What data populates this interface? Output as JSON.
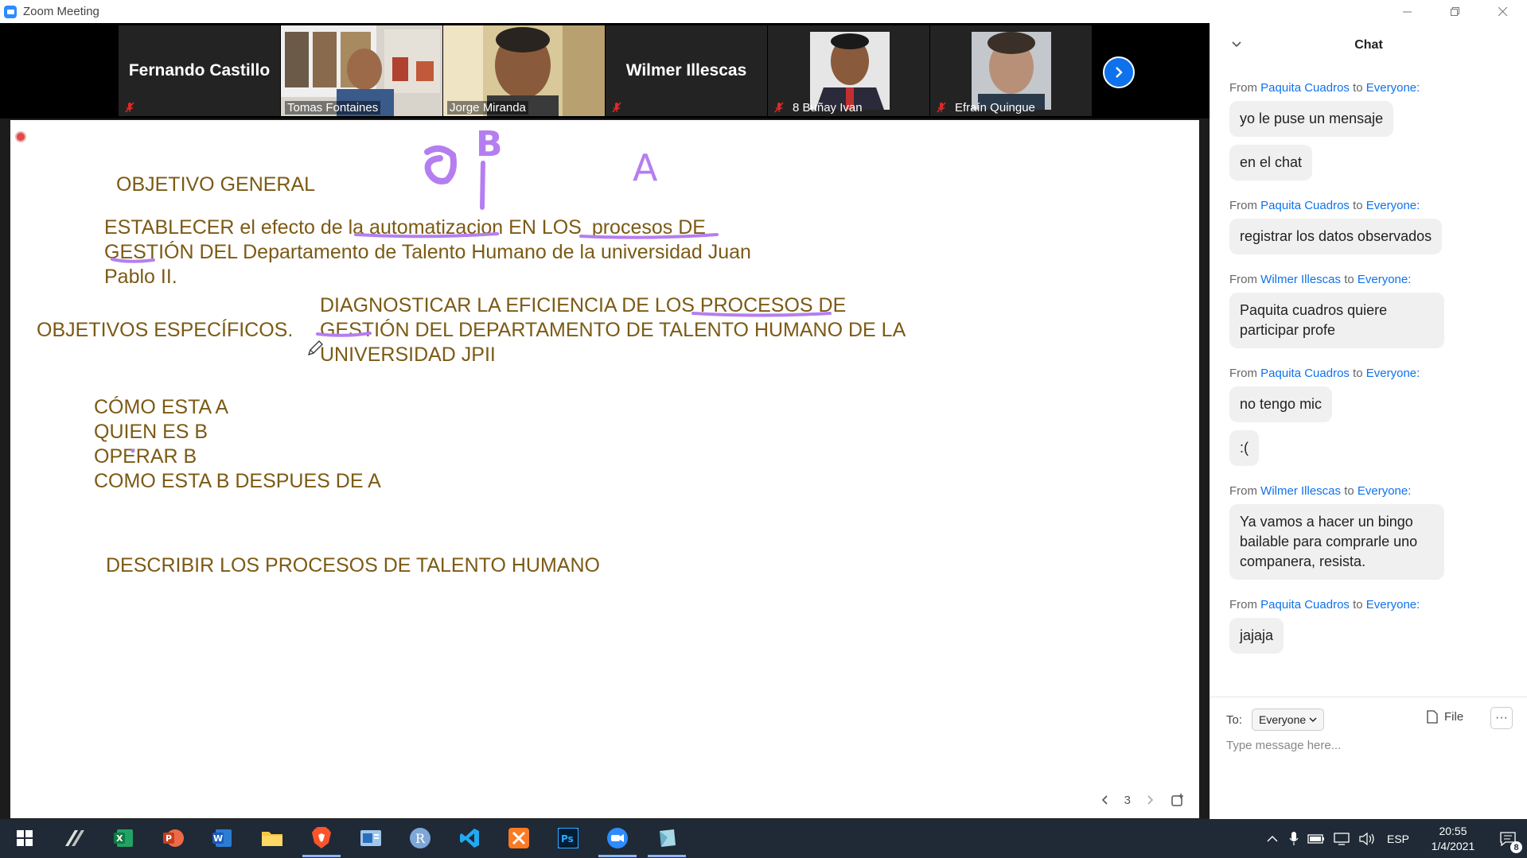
{
  "window": {
    "title": "Zoom Meeting"
  },
  "participants": [
    {
      "name": "Fernando Castillo",
      "type": "name-only",
      "muted": true
    },
    {
      "name": "Tomas Fontaines",
      "type": "video",
      "muted": false,
      "active": true
    },
    {
      "name": "Jorge Miranda",
      "type": "video",
      "muted": false
    },
    {
      "name": "Wilmer Illescas",
      "type": "name-only",
      "muted": true
    },
    {
      "name": "8 Buñay Ivan",
      "type": "photo",
      "muted": true
    },
    {
      "name": "Efraín Quingue",
      "type": "photo",
      "muted": true
    }
  ],
  "whiteboard": {
    "objetivo_general": "OBJETIVO GENERAL",
    "general_line1_a": "ESTABLECER el efecto de la",
    "general_line1_b": "automatizacion",
    "general_line1_c": "EN LOS",
    "general_line1_d": "procesos DE",
    "general_line2": "GESTIÓN DEL  Departamento de Talento Humano de la universidad Juan",
    "general_line3": "Pablo II.",
    "objetivos_especificos": "OBJETIVOS ESPECÍFICOS.",
    "esp_line1": "DIAGNOSTICAR LA EFICIENCIA DE LOS PROCESOS DE",
    "esp_line2": "GESTIÓN  DEL DEPARTAMENTO DE TALENTO HUMANO DE LA",
    "esp_line3": "UNIVERSIDAD  JPII",
    "step1": "CÓMO ESTA A",
    "step2": "QUIEN ES B",
    "step3": "OPERAR B",
    "step4": "COMO ESTA B DESPUES DE A",
    "describir": "DESCRIBIR LOS PROCESOS DE TALENTO HUMANO",
    "annotation_a": "A",
    "annotation_b": "B",
    "page": "3"
  },
  "chat": {
    "title": "Chat",
    "to_label": "To:",
    "recipient": "Everyone",
    "file_label": "File",
    "more_label": "···",
    "placeholder": "Type message here...",
    "messages": [
      {
        "from": "Paquita Cuadros",
        "to": "Everyone",
        "texts": [
          "yo le puse un mensaje",
          "en el chat"
        ]
      },
      {
        "from": "Paquita Cuadros",
        "to": "Everyone",
        "texts": [
          "registrar los datos observados"
        ]
      },
      {
        "from": "Wilmer Illescas",
        "to": "Everyone",
        "texts": [
          "Paquita cuadros quiere participar profe"
        ]
      },
      {
        "from": "Paquita Cuadros",
        "to": "Everyone",
        "texts": [
          "no tengo mic",
          ":("
        ]
      },
      {
        "from": "Wilmer Illescas",
        "to": "Everyone",
        "texts": [
          "Ya vamos a hacer un bingo bailable para comprarle uno companera, resista."
        ]
      },
      {
        "from": "Paquita Cuadros",
        "to": "Everyone",
        "texts": [
          "jajaja"
        ]
      }
    ],
    "from_prefix": "From",
    "to_word": "to"
  },
  "taskbar": {
    "apps": [
      "start-icon",
      "autodesk-icon",
      "excel-icon",
      "powerpoint-icon",
      "word-icon",
      "file-explorer-icon",
      "brave-icon",
      "outlook-icon",
      "r-icon",
      "vscode-icon",
      "xampp-icon",
      "photoshop-icon",
      "zoom-icon",
      "app-icon"
    ],
    "language": "ESP",
    "time": "20:55",
    "date": "1/4/2021",
    "notifications": "8"
  },
  "colors": {
    "accent": "#0e72ed",
    "whiteboard_text": "#7c5a14",
    "ink": "#b57ef0",
    "active_speaker": "#8fd14f"
  }
}
